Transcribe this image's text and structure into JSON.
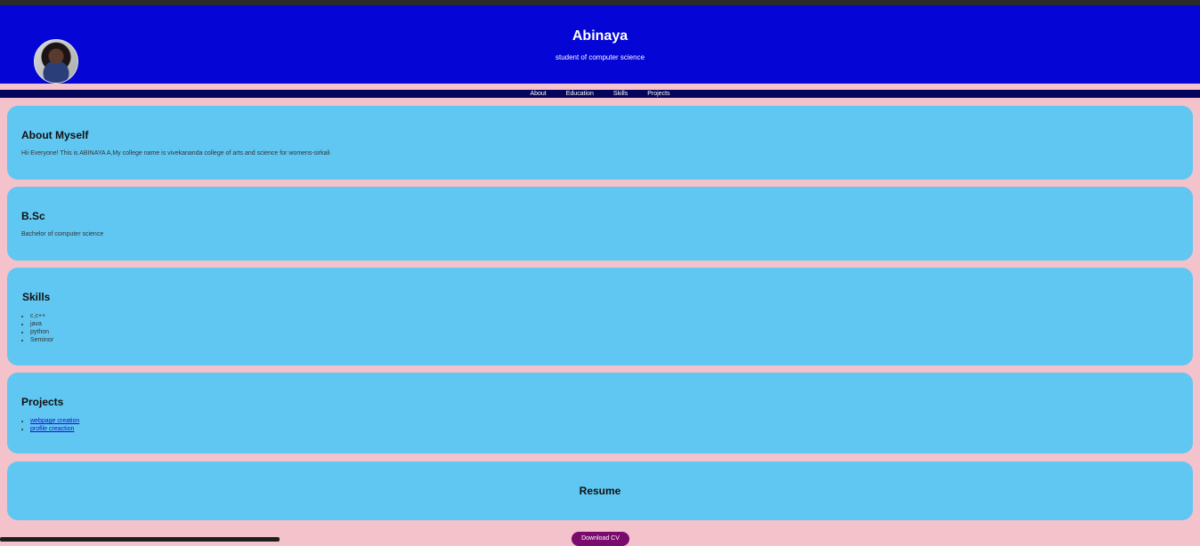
{
  "header": {
    "name": "Abinaya",
    "tagline": "student of computer science"
  },
  "nav": {
    "items": [
      {
        "label": "About"
      },
      {
        "label": "Education"
      },
      {
        "label": "Skills"
      },
      {
        "label": "Projects"
      }
    ]
  },
  "about": {
    "title": "About Myself",
    "text": "Hii Everyone! This is ABINAYA A,My college name is vivekananda college of arts and science for womens-sirkali"
  },
  "education": {
    "title": "B.Sc",
    "text": "Bachelor of computer science"
  },
  "skills": {
    "title": "Skills",
    "items": [
      "c,c++",
      "java",
      "python",
      "Seminor"
    ]
  },
  "projects": {
    "title": "Projects",
    "items": [
      "webpage creation",
      "profile creaction"
    ]
  },
  "resume": {
    "title": "Resume",
    "button_label": "Download CV"
  },
  "colors": {
    "page_bg": "#f4c2cb",
    "header_bg": "#0505d6",
    "nav_bg": "#05055c",
    "card_bg": "#60c7f2",
    "button_bg": "#7a0a6e"
  }
}
